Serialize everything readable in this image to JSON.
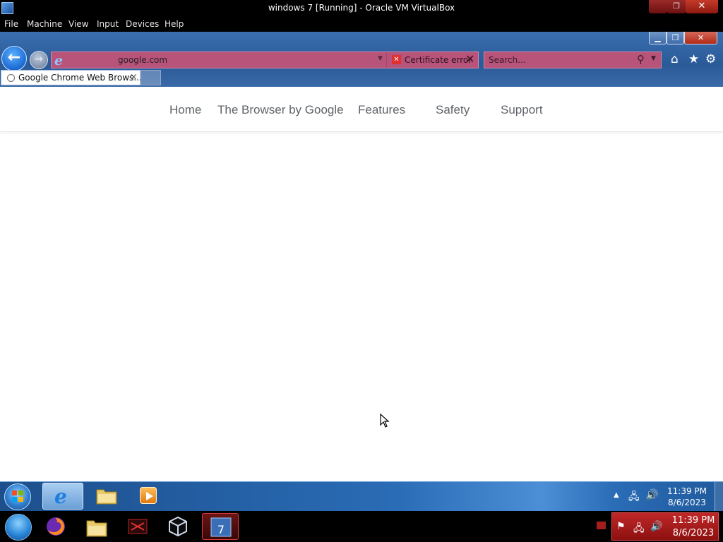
{
  "host_window": {
    "title": "windows 7 [Running] - Oracle VM VirtualBox",
    "menu": [
      "File",
      "Machine",
      "View",
      "Input",
      "Devices",
      "Help"
    ]
  },
  "browser": {
    "address_url": "google.com",
    "certificate_error_label": "Certificate error",
    "search_placeholder": "Search...",
    "tab_title": "Google Chrome Web Brows...",
    "tab_close_glyph": "×"
  },
  "page": {
    "nav_links": [
      "Home",
      "The Browser by Google",
      "Features",
      "Safety",
      "Support"
    ]
  },
  "guest_taskbar": {
    "clock_time": "11:39 PM",
    "clock_date": "8/6/2023"
  },
  "host_taskbar": {
    "clock_time": "11:39 PM",
    "clock_date": "8/6/2023"
  },
  "colors": {
    "ie_address_bar": "#b85379",
    "ie_chrome": "#2a5a98",
    "nav_text": "#5f6368",
    "host_tray": "#c02828"
  },
  "icons": {
    "back": "back-arrow-icon",
    "forward": "forward-arrow-icon",
    "home": "home-icon",
    "favorites": "star-icon",
    "tools": "gear-icon",
    "search": "search-icon"
  }
}
